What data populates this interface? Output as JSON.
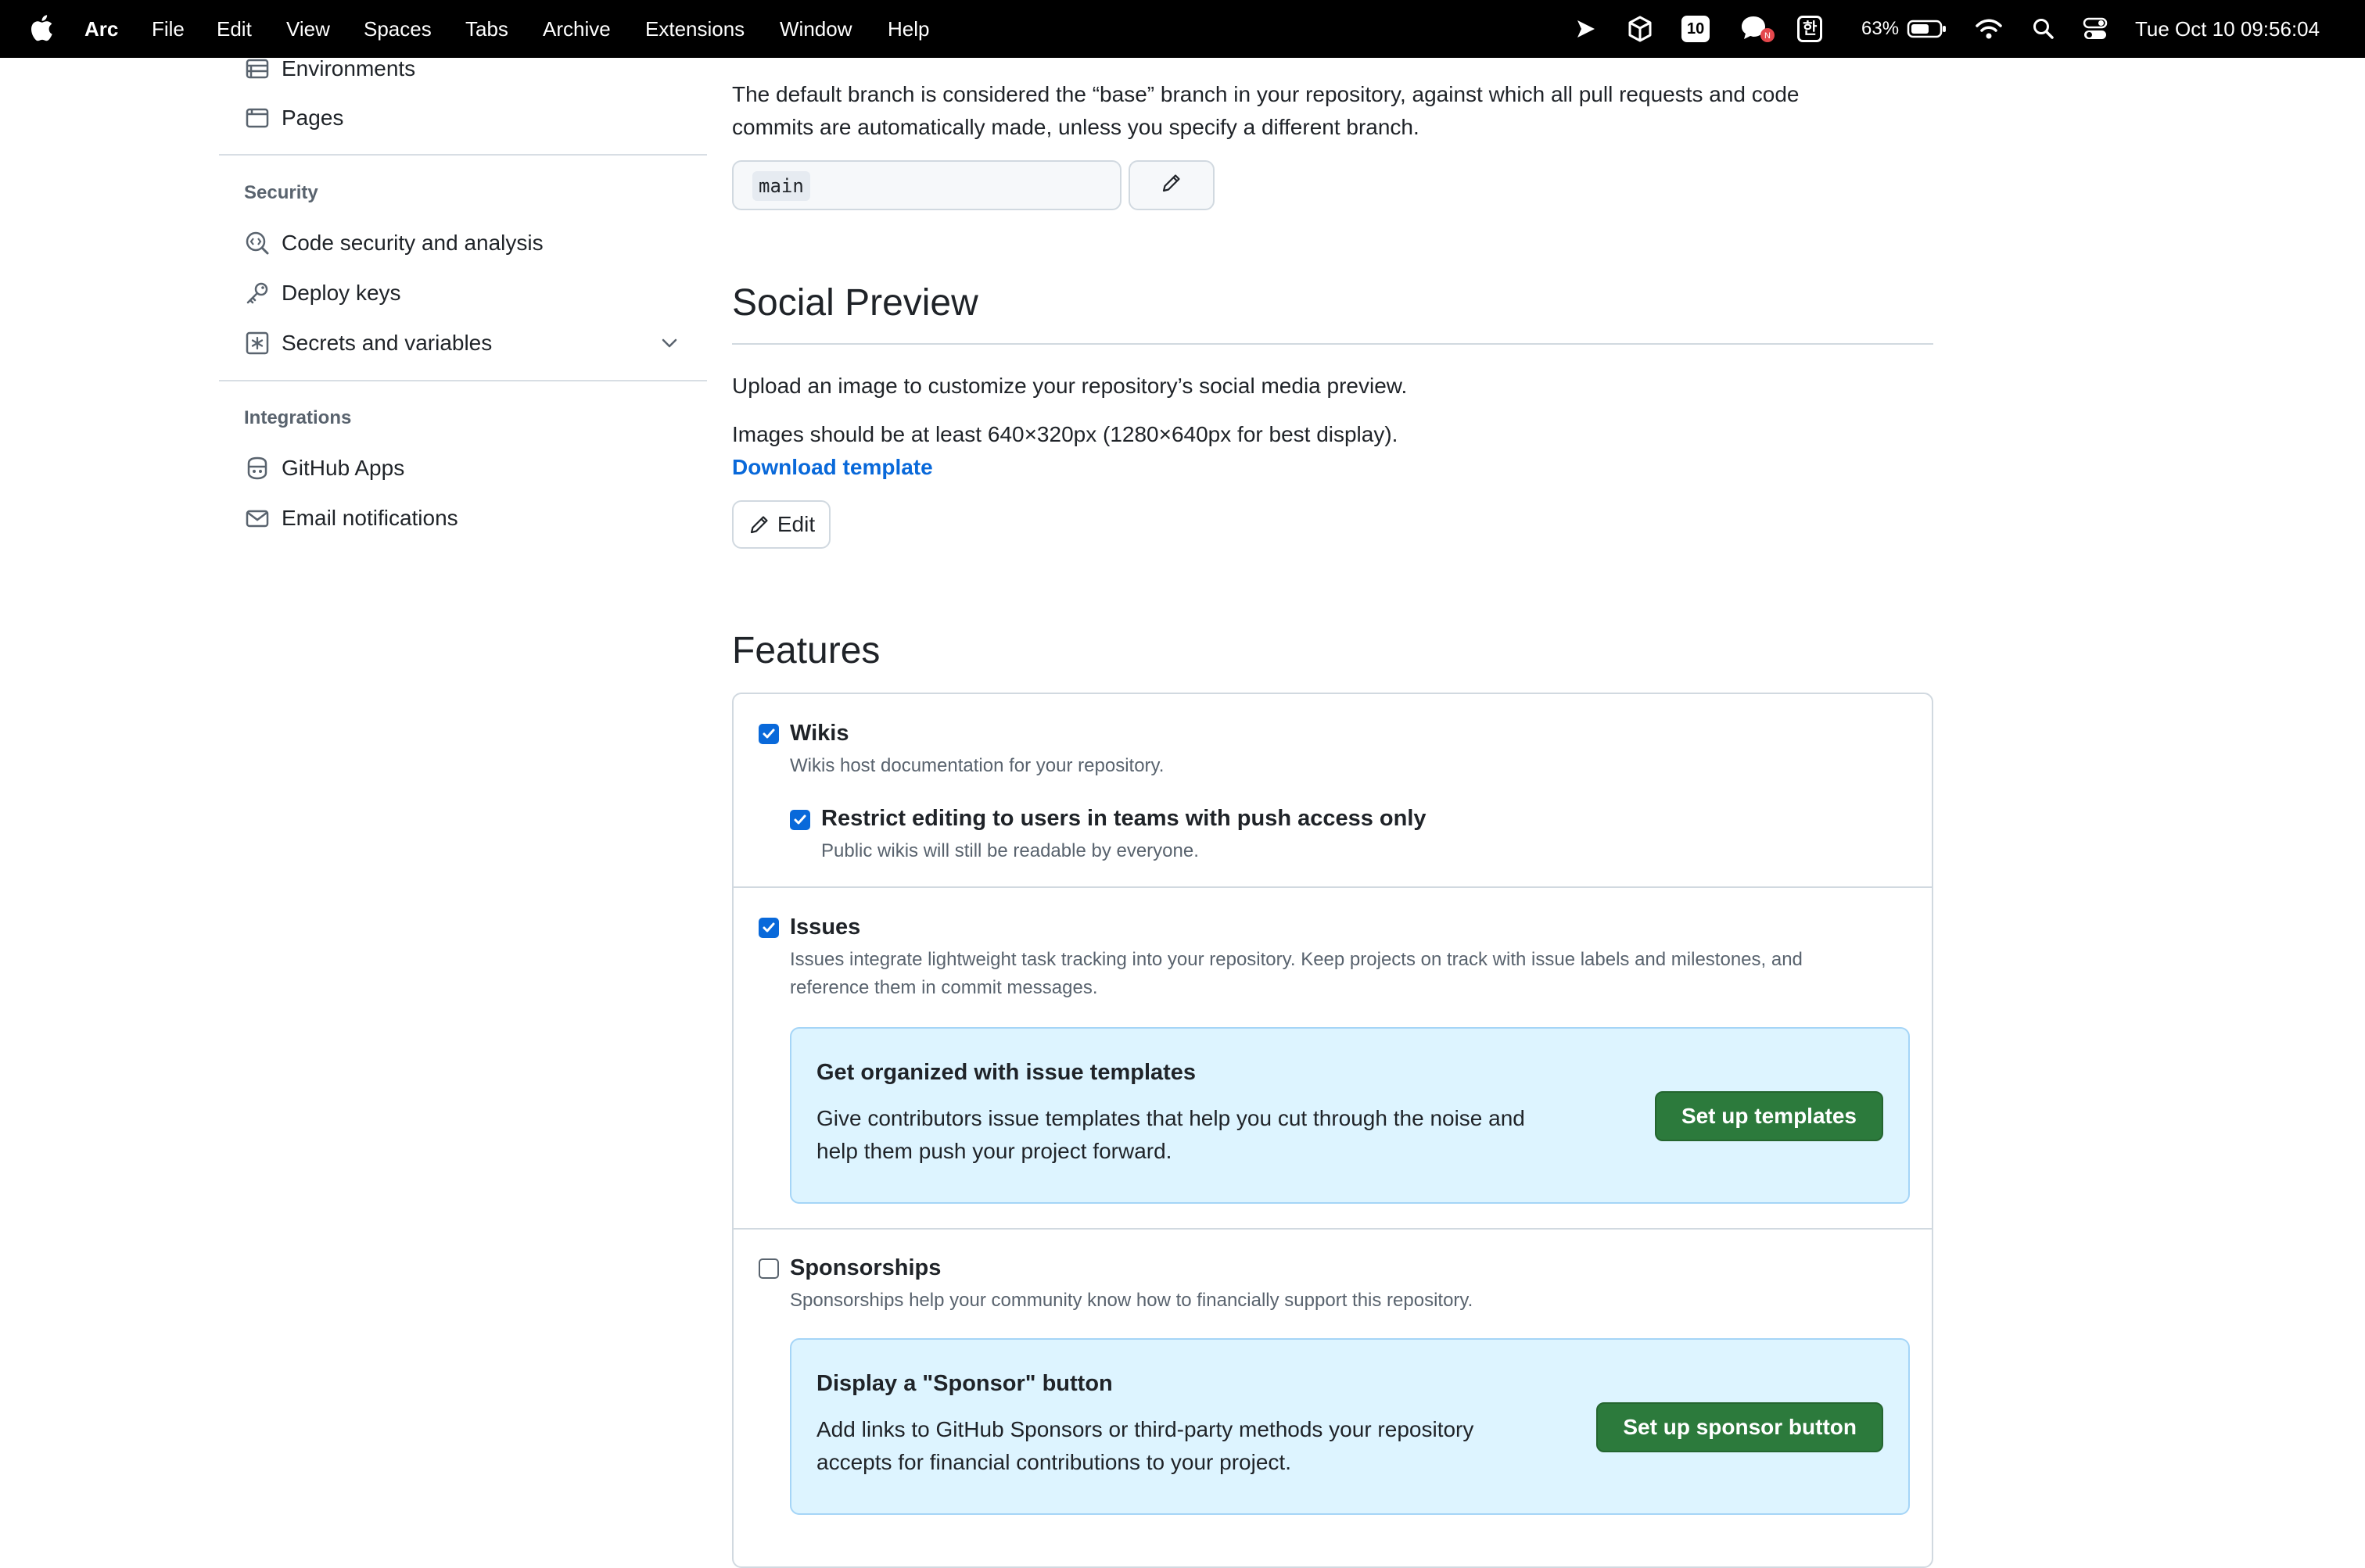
{
  "menubar": {
    "app": "Arc",
    "items": [
      "File",
      "Edit",
      "View",
      "Spaces",
      "Tabs",
      "Archive",
      "Extensions",
      "Window",
      "Help"
    ],
    "badge_number": "10",
    "korean_input": "한",
    "battery": "63%",
    "datetime": "Tue Oct 10  09:56:04"
  },
  "sidebar": {
    "code_items": [
      "Environments",
      "Pages"
    ],
    "security_heading": "Security",
    "security_items": [
      "Code security and analysis",
      "Deploy keys",
      "Secrets and variables"
    ],
    "integrations_heading": "Integrations",
    "integrations_items": [
      "GitHub Apps",
      "Email notifications"
    ]
  },
  "default_branch": {
    "description_line1": "The default branch is considered the “base” branch in your repository, against which all pull requests and code",
    "description_line2": "commits are automatically made, unless you specify a different branch.",
    "branch_name": "main"
  },
  "social_preview": {
    "heading": "Social Preview",
    "upload_text": "Upload an image to customize your repository’s social media preview.",
    "size_text": "Images should be at least 640×320px (1280×640px for best display).",
    "download_link": "Download template",
    "edit_label": "Edit"
  },
  "features": {
    "heading": "Features",
    "wikis": {
      "title": "Wikis",
      "checked": true,
      "desc": "Wikis host documentation for your repository.",
      "restrict_title": "Restrict editing to users in teams with push access only",
      "restrict_checked": true,
      "restrict_desc": "Public wikis will still be readable by everyone."
    },
    "issues": {
      "title": "Issues",
      "checked": true,
      "desc_line1": "Issues integrate lightweight task tracking into your repository. Keep projects on track with issue labels and milestones, and",
      "desc_line2": "reference them in commit messages.",
      "callout_title": "Get organized with issue templates",
      "callout_desc": "Give contributors issue templates that help you cut through the noise and help them push your project forward.",
      "callout_button": "Set up templates"
    },
    "sponsorships": {
      "title": "Sponsorships",
      "checked": false,
      "desc": "Sponsorships help your community know how to financially support this repository.",
      "callout_title": "Display a \"Sponsor\" button",
      "callout_desc": "Add links to GitHub Sponsors or third-party methods your repository accepts for financial contributions to your project.",
      "callout_button": "Set up sponsor button"
    }
  },
  "colors": {
    "accent_blue": "#0969da",
    "button_green": "#2c7a3c",
    "callout_bg": "#ddf4ff",
    "menubar_bg": "#000000"
  }
}
